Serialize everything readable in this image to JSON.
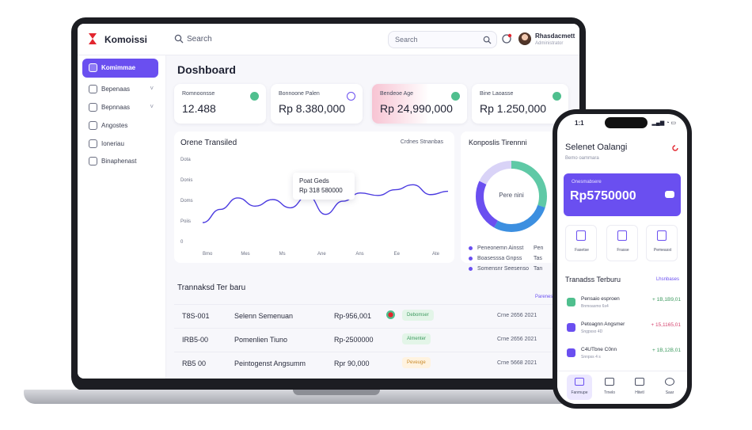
{
  "app": {
    "brand": "Komoissi",
    "user_name": "Rhasdacmett",
    "user_role": "Administrator"
  },
  "topbar": {
    "search_label": "Search",
    "search_box_placeholder": "Search"
  },
  "sidebar": {
    "items": [
      {
        "label": "Komimmae",
        "icon": "home-icon",
        "active": true
      },
      {
        "label": "Bepenaas",
        "icon": "wallet-icon",
        "chevron": "˅"
      },
      {
        "label": "Bepnnaas",
        "icon": "chart-icon",
        "chevron": "˅"
      },
      {
        "label": "Angostes",
        "icon": "list-icon"
      },
      {
        "label": "Ioneriau",
        "icon": "calendar-icon"
      },
      {
        "label": "Binaphenast",
        "icon": "document-icon"
      }
    ]
  },
  "dashboard": {
    "title": "Doshboard",
    "stats": [
      {
        "label": "Romnoonsse",
        "value": "12.488",
        "icon_color": "#4fbf8e"
      },
      {
        "label": "Bonnoone Palen",
        "value": "Rp 8.380,000",
        "icon_color": "#6a4ff0"
      },
      {
        "label": "Bendeoe Age",
        "value": "Rp 24,990,000",
        "icon_color": "#4fbf8e"
      },
      {
        "label": "Bine Laoasse",
        "value": "Rp 1.250,000",
        "icon_color": "#4fbf8e"
      }
    ],
    "line_chart": {
      "title": "Orene Transiled",
      "filter": "Crdnes Stnanbas",
      "tooltip_line1": "Poat Geds",
      "tooltip_line2": "Rp 318 580000"
    },
    "composition": {
      "title": "Konposlis Tirennni",
      "center": "Pere nini",
      "legend": [
        {
          "label": "Peneonemn Ainsst",
          "right": "Pen",
          "color": "#6a4ff0"
        },
        {
          "label": "Boasesssa Gnpss",
          "right": "Tas",
          "color": "#6a4ff0"
        },
        {
          "label": "Somensnr Seesenso",
          "right": "Tan",
          "color": "#6a4ff0"
        }
      ]
    },
    "transactions": {
      "title": "Trannaksd Ter baru",
      "more": "Parenes",
      "rows": [
        {
          "id": "T8S-001",
          "name": "Selenn Semenuan",
          "amount": "Rp-956,001",
          "status": "Debomser",
          "status_color": "#e3f5e8",
          "status_text_color": "#3d9a5f",
          "date": "Crne 2656 2021"
        },
        {
          "id": "IRB5-00",
          "name": "Pomenlien Tiuno",
          "amount": "Rp-2500000",
          "status": "Almenter",
          "status_color": "#e3f5e8",
          "status_text_color": "#3d9a5f",
          "date": "Crne 2656 2021"
        },
        {
          "id": "RB5 00",
          "name": "Peintogenst Angsumm",
          "amount": "Rpr 90,000",
          "status": "Peveuge",
          "status_color": "#fff3e0",
          "status_text_color": "#c98a2a",
          "date": "Crne 5668 2021"
        }
      ]
    }
  },
  "chart_data": {
    "type": "line",
    "title": "Orene Transiled",
    "categories": [
      "Bmo",
      "Mes",
      "Ms",
      "Ane",
      "Ans",
      "Ee",
      "Ate"
    ],
    "y_tick_labels": [
      "Dota",
      "Donis",
      "Doms",
      "Poiis",
      "0"
    ],
    "values": [
      22,
      38,
      52,
      42,
      50,
      40,
      55,
      32,
      48,
      58,
      55,
      62,
      68,
      56,
      60
    ],
    "ylim": [
      0,
      100
    ]
  },
  "donut_data": {
    "type": "pie",
    "segments": [
      {
        "value": 30,
        "color": "#5fc9a6"
      },
      {
        "value": 28,
        "color": "#3c8fe0"
      },
      {
        "value": 24,
        "color": "#6a4ff0"
      },
      {
        "value": 18,
        "color": "#d9d3f7"
      }
    ]
  },
  "phone": {
    "time": "1:1",
    "status": "▂▄▆ ◔ ▭",
    "greeting": "Selenet Oalangi",
    "subtitle": "Bemo oammara",
    "balance_label": "Onesmabsere",
    "balance_value": "Rp5750000",
    "quick_actions": [
      {
        "label": "Fasetse",
        "icon": "download-icon"
      },
      {
        "label": "Frasse",
        "icon": "upload-icon"
      },
      {
        "label": "Pemeasst",
        "icon": "calendar-icon"
      }
    ],
    "tx_title": "Tranadss Terburu",
    "tx_more": "Lhsnbases",
    "tx": [
      {
        "name": "Pensaio esproen",
        "sub": "Bnmoasmo 6s4",
        "amount": "+ 1B,1B9,01",
        "color": "#3d9a5f",
        "icon_color": "#4fbf8e"
      },
      {
        "name": "Petoagnn Angsmer",
        "sub": "Sngpsso 4D",
        "amount": "+ 15,1165,01",
        "color": "#d64570",
        "icon_color": "#6a4ff0"
      },
      {
        "name": "C4UTbne C0nn",
        "sub": "Snnpss 4 s",
        "amount": "+ 1B,12B,01",
        "color": "#3d9a5f",
        "icon_color": "#6a4ff0"
      }
    ],
    "nav": [
      {
        "label": "Fanmupe",
        "icon": "home-icon",
        "active": true
      },
      {
        "label": "Trnelo",
        "icon": "card-icon"
      },
      {
        "label": "Hitetl",
        "icon": "wallet-icon"
      },
      {
        "label": "Saar",
        "icon": "user-icon"
      }
    ]
  }
}
